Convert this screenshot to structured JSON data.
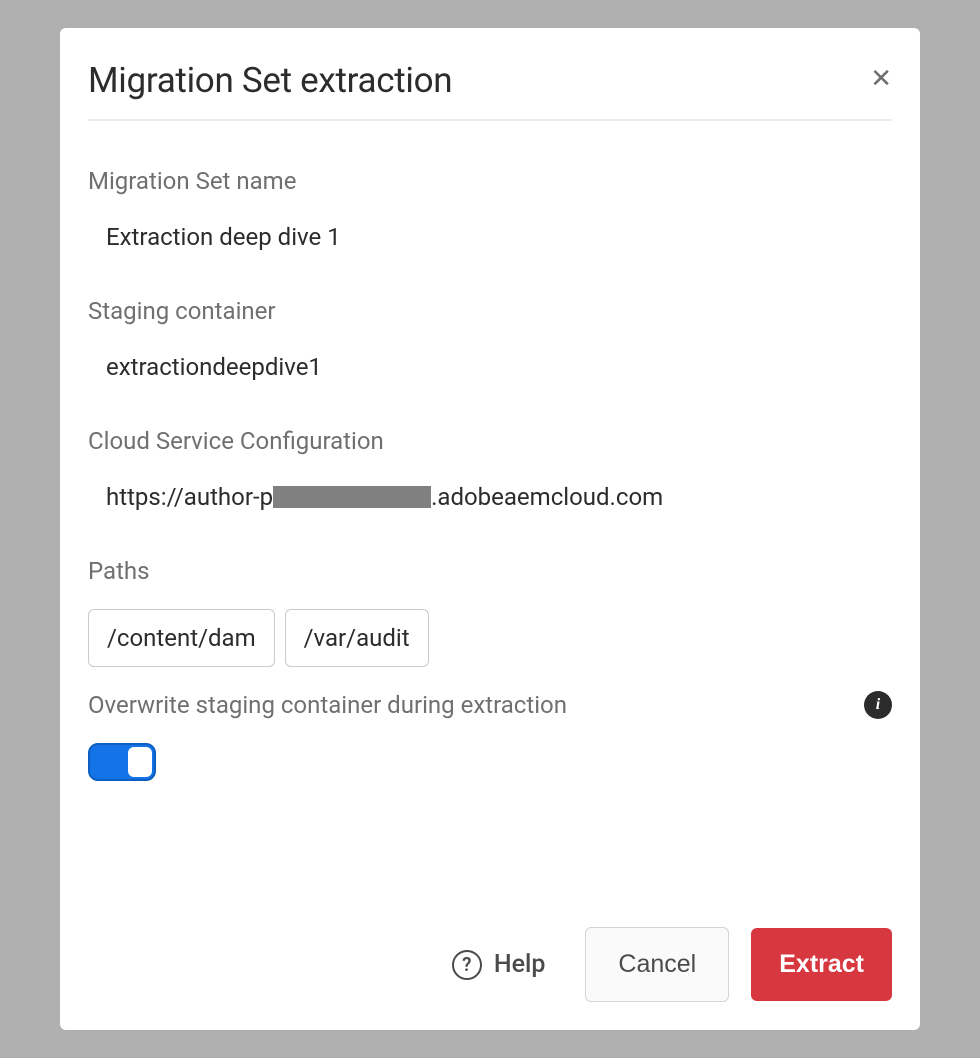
{
  "dialog": {
    "title": "Migration Set extraction"
  },
  "fields": {
    "migration_set_name": {
      "label": "Migration Set name",
      "value": "Extraction deep dive 1"
    },
    "staging_container": {
      "label": "Staging container",
      "value": "extractiondeepdive1"
    },
    "cloud_config": {
      "label": "Cloud Service Configuration",
      "url_prefix": "https://author-p",
      "url_suffix": ".adobeaemcloud.com"
    },
    "paths": {
      "label": "Paths",
      "items": [
        "/content/dam",
        "/var/audit"
      ]
    },
    "overwrite": {
      "label": "Overwrite staging container during extraction",
      "value": true
    }
  },
  "footer": {
    "help_label": "Help",
    "cancel_label": "Cancel",
    "extract_label": "Extract"
  }
}
